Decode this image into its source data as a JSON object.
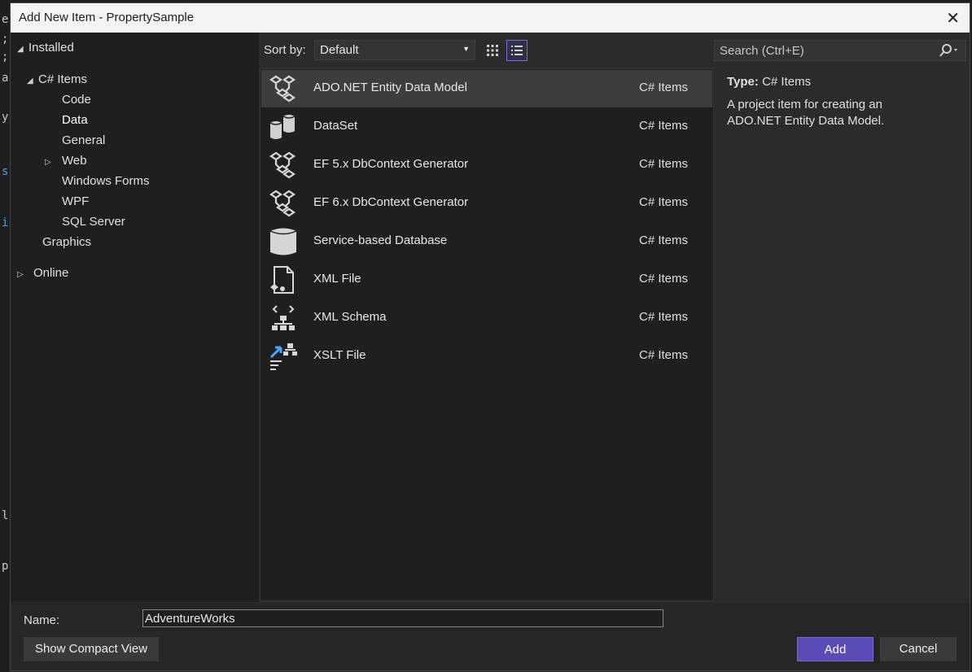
{
  "dialog": {
    "title": "Add New Item - PropertySample"
  },
  "tree": {
    "installed": "Installed",
    "csharp_items": "C# Items",
    "children": [
      "Code",
      "Data",
      "General",
      "Web",
      "Windows Forms",
      "WPF",
      "SQL Server"
    ],
    "graphics": "Graphics",
    "online": "Online"
  },
  "toolbar": {
    "sort_label": "Sort by:",
    "sort_value": "Default"
  },
  "search": {
    "placeholder": "Search (Ctrl+E)"
  },
  "items": [
    {
      "name": "ADO.NET Entity Data Model",
      "category": "C# Items",
      "icon": "entity-model-icon"
    },
    {
      "name": "DataSet",
      "category": "C# Items",
      "icon": "dataset-icon"
    },
    {
      "name": "EF 5.x DbContext Generator",
      "category": "C# Items",
      "icon": "entity-model-icon"
    },
    {
      "name": "EF 6.x DbContext Generator",
      "category": "C# Items",
      "icon": "entity-model-icon"
    },
    {
      "name": "Service-based Database",
      "category": "C# Items",
      "icon": "database-icon"
    },
    {
      "name": "XML File",
      "category": "C# Items",
      "icon": "xml-file-icon"
    },
    {
      "name": "XML Schema",
      "category": "C# Items",
      "icon": "xml-schema-icon"
    },
    {
      "name": "XSLT File",
      "category": "C# Items",
      "icon": "xslt-file-icon"
    }
  ],
  "details": {
    "type_label": "Type:",
    "type_value": "C# Items",
    "description": "A project item for creating an ADO.NET Entity Data Model."
  },
  "bottom": {
    "name_label": "Name:",
    "name_value": "AdventureWorks",
    "compact_label": "Show Compact View",
    "add_label": "Add",
    "cancel_label": "Cancel"
  },
  "background_editor": {
    "glyphs": [
      "e",
      ";",
      ";",
      "a",
      "y",
      "s",
      "i",
      "l",
      "p"
    ]
  }
}
